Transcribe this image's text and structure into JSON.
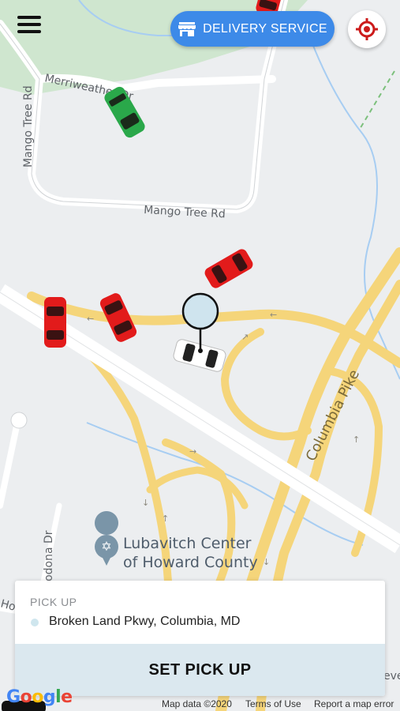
{
  "map": {
    "roads": {
      "merriweather": "Merriweather Dr",
      "mango_vertical": "Mango Tree Rd",
      "mango_horizontal": "Mango Tree Rd",
      "rodona": "Rodona Dr",
      "howard_partial": "Hov",
      "columbia_pike": "Columbia Pike",
      "bottom_right_partial": "eve"
    },
    "poi": {
      "line1": "Lubavitch Center",
      "line2": "of Howard County"
    },
    "colors": {
      "land": "#eceef0",
      "park": "#cfe6cf",
      "water": "#a7cdf2",
      "highway": "#f5d57a",
      "car_red": "#e21b1b",
      "car_green": "#2aa84a"
    }
  },
  "top_bar": {
    "menu_icon": "hamburger-menu-icon",
    "delivery_label": "DELIVERY SERVICE",
    "delivery_icon": "store-icon",
    "locate_icon": "crosshair-target-icon",
    "delivery_color": "#3d8ae8",
    "locate_color": "#cc1b1b"
  },
  "pickup": {
    "label": "PICK UP",
    "address": "Broken Land Pkwy, Columbia, MD",
    "button_label": "SET PICK UP"
  },
  "footer": {
    "logo_letters": [
      "G",
      "o",
      "o",
      "g",
      "l",
      "e"
    ],
    "map_data": "Map data ©2020",
    "terms": "Terms of Use",
    "report": "Report a map error"
  }
}
